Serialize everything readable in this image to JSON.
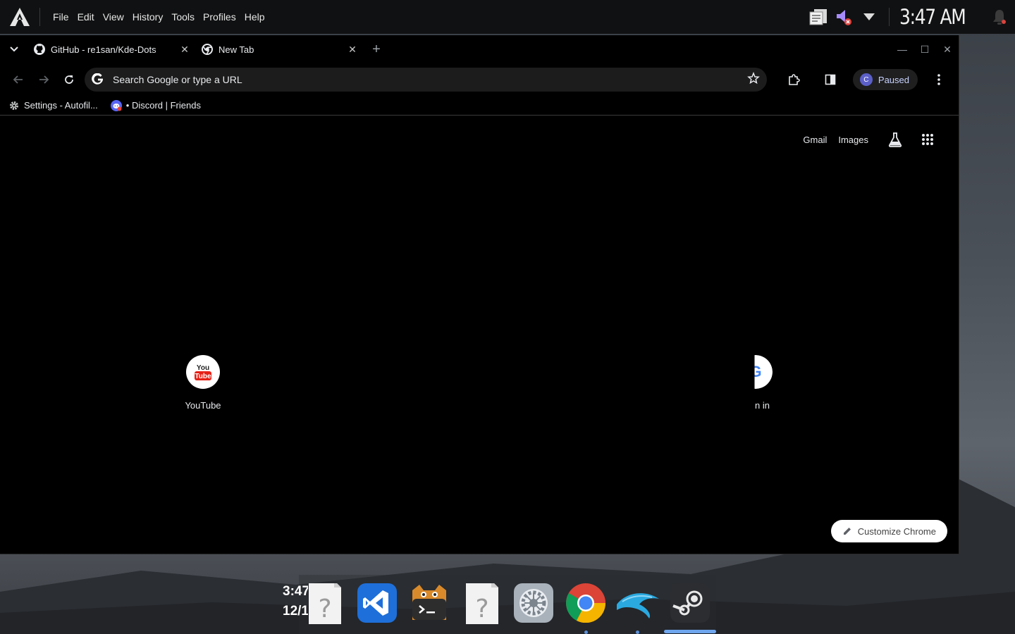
{
  "top_panel": {
    "menu": [
      "File",
      "Edit",
      "View",
      "History",
      "Tools",
      "Profiles",
      "Help"
    ],
    "clock": "3:47 AM"
  },
  "browser": {
    "tabs": [
      {
        "title": "GitHub - re1san/Kde-Dots",
        "icon": "github-icon"
      },
      {
        "title": "New Tab",
        "icon": "chrome-icon"
      }
    ],
    "omnibox": {
      "placeholder": "Search Google or type a URL"
    },
    "profile": {
      "initial": "C",
      "label": "Paused"
    },
    "bookmarks": [
      {
        "title": "Settings - Autofil...",
        "icon": "gear-icon"
      },
      {
        "title": "• Discord | Friends",
        "icon": "discord-icon"
      }
    ]
  },
  "ntp": {
    "links": {
      "gmail": "Gmail",
      "images": "Images"
    },
    "shortcuts": [
      {
        "label": "YouTube",
        "icon": "youtube-icon"
      },
      {
        "label": "n in",
        "icon": "google-icon"
      }
    ],
    "customize": "Customize Chrome"
  },
  "dock": {
    "clock_time": "3:47",
    "clock_date": "12/1",
    "apps": [
      "unknown-file-icon",
      "vscode-icon",
      "terminal-icon",
      "unknown-file-icon",
      "settings-icon",
      "chrome-icon",
      "dolphin-icon",
      "steam-icon"
    ]
  },
  "colors": {
    "panel": "#101112",
    "window_bg": "#000000",
    "omnibox_bg": "#1c1c1c",
    "accent": "#6fa6ee"
  }
}
